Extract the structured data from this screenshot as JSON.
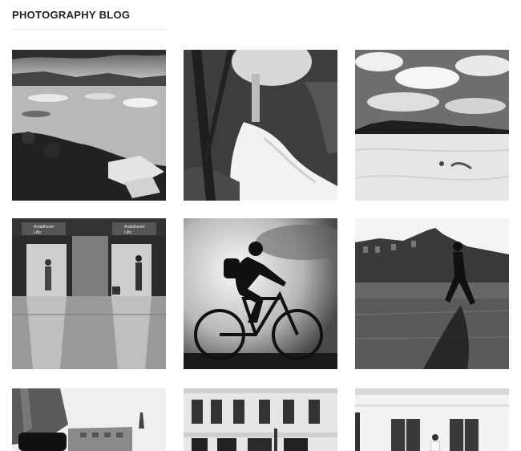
{
  "blog": {
    "title": "PHOTOGRAPHY BLOG"
  },
  "gallery": {
    "photos": [
      {
        "subject": "glacier-lagoon"
      },
      {
        "subject": "forest-waterfall"
      },
      {
        "subject": "desert-mountains"
      },
      {
        "subject": "airport-lifts"
      },
      {
        "subject": "cyclist-silhouette"
      },
      {
        "subject": "walker-city"
      },
      {
        "subject": "building-facade"
      },
      {
        "subject": "building-windows"
      },
      {
        "subject": "pale-building"
      }
    ],
    "signs": {
      "text": "Ardaitheoirí",
      "lifts": "Lifts"
    }
  }
}
